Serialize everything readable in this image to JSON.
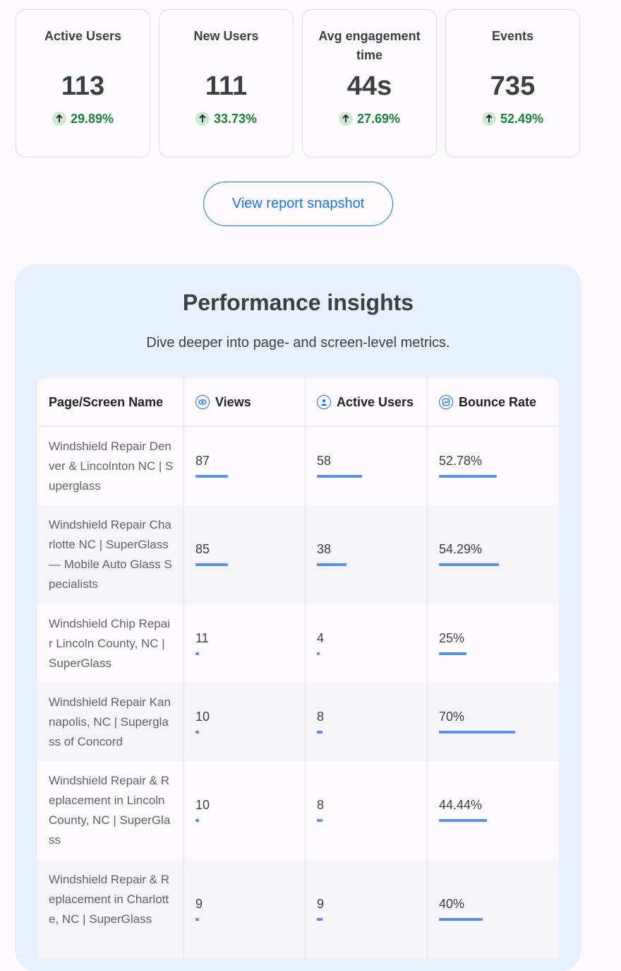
{
  "cards": [
    {
      "title": "Active Users",
      "value": "113",
      "delta": "29.89%"
    },
    {
      "title": "New Users",
      "value": "111",
      "delta": "33.73%"
    },
    {
      "title": "Avg engagement time",
      "value": "44s",
      "delta": "27.69%"
    },
    {
      "title": "Events",
      "value": "735",
      "delta": "52.49%"
    }
  ],
  "snapshot_button": "View report snapshot",
  "insights": {
    "title": "Performance insights",
    "subtitle": "Dive deeper into page- and screen-level metrics.",
    "columns": [
      "Page/Screen Name",
      "Views",
      "Active Users",
      "Bounce Rate"
    ],
    "column_icons": [
      "",
      "eye-icon",
      "user-icon",
      "chart-icon"
    ],
    "rows": [
      {
        "name": "Windshield Repair Denver & Lincolnton NC | Superglass",
        "views": "87",
        "views_share": 0.3,
        "users": "58",
        "users_share": 0.46,
        "bounce": "52.78%",
        "bounce_share": 0.53
      },
      {
        "name": "Windshield Repair Charlotte NC | SuperGlass — Mobile Auto Glass Specialists",
        "views": "85",
        "views_share": 0.3,
        "users": "38",
        "users_share": 0.3,
        "bounce": "54.29%",
        "bounce_share": 0.55
      },
      {
        "name": "Windshield Chip Repair Lincoln County, NC | SuperGlass",
        "views": "11",
        "views_share": 0.03,
        "users": "4",
        "users_share": 0.03,
        "bounce": "25%",
        "bounce_share": 0.25
      },
      {
        "name": "Windshield Repair Kannapolis, NC | Superglass of Concord",
        "views": "10",
        "views_share": 0.03,
        "users": "8",
        "users_share": 0.06,
        "bounce": "70%",
        "bounce_share": 0.7
      },
      {
        "name": "Windshield Repair & Replacement in Lincoln County, NC | SuperGlass",
        "views": "10",
        "views_share": 0.03,
        "users": "8",
        "users_share": 0.06,
        "bounce": "44.44%",
        "bounce_share": 0.44
      },
      {
        "name": "Windshield Repair & Replacement in Charlotte, NC | SuperGlass",
        "views": "9",
        "views_share": 0.03,
        "users": "9",
        "users_share": 0.06,
        "bounce": "40%",
        "bounce_share": 0.4
      }
    ]
  },
  "colors": {
    "accent": "#1a73e8",
    "positive": "#188038",
    "bar": "#5b8ee6",
    "panel": "#e8effd"
  }
}
